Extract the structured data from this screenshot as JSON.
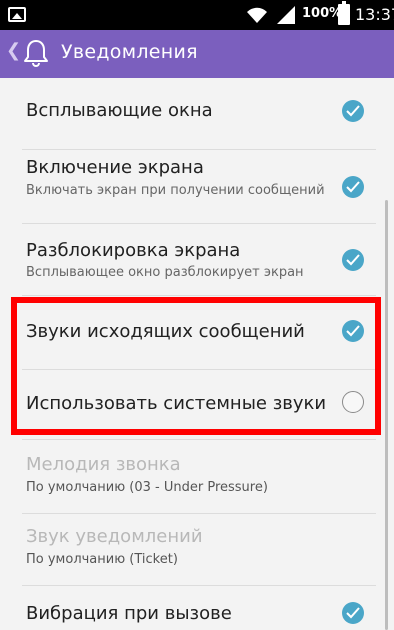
{
  "status_bar": {
    "battery_percent": "100%",
    "time": "13:37",
    "icons": [
      "image-icon",
      "wifi-icon",
      "signal-icon",
      "battery-icon"
    ]
  },
  "app_bar": {
    "title": "Уведомления",
    "icons": [
      "back-chevron-icon",
      "bell-icon"
    ]
  },
  "settings": [
    {
      "title": "Всплывающие окна",
      "summary": "",
      "checked": true,
      "enabled": true
    },
    {
      "title": "Включение экрана",
      "summary": "Включать экран при получении сообщений",
      "checked": true,
      "enabled": true
    },
    {
      "title": "Разблокировка экрана",
      "summary": "Всплывающее окно разблокирует экран",
      "checked": true,
      "enabled": true
    },
    {
      "title": "Звуки исходящих сообщений",
      "summary": "",
      "checked": true,
      "enabled": true
    },
    {
      "title": "Использовать системные звуки",
      "summary": "",
      "checked": false,
      "enabled": true
    },
    {
      "title": "Мелодия звонка",
      "summary": "По умолчанию (03 - Under Pressure)",
      "enabled": false
    },
    {
      "title": "Звук уведомлений",
      "summary": "По умолчанию (Ticket)",
      "enabled": false
    },
    {
      "title": "Вибрация при вызове",
      "summary": "",
      "checked": true,
      "enabled": true
    }
  ],
  "colors": {
    "app_bar": "#7b5fbe",
    "checkbox_checked": "#4aa6c8",
    "highlight": "#ff0000"
  }
}
